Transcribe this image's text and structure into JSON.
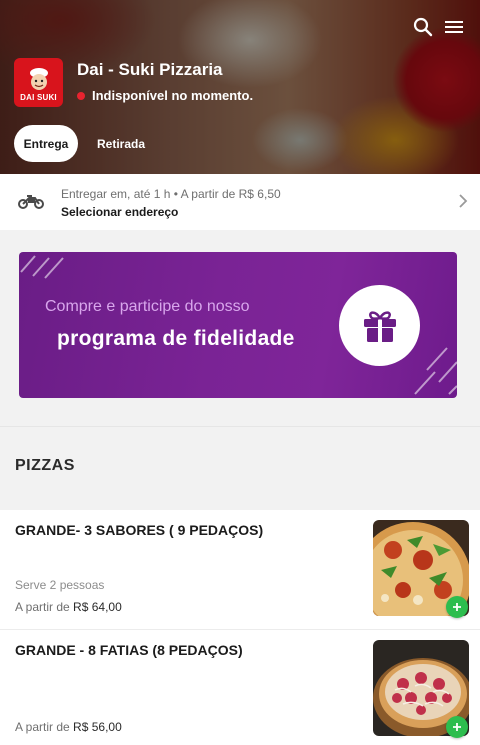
{
  "header": {
    "store_name": "Dai - Suki Pizzaria",
    "status_text": "Indisponível no momento.",
    "logo_text": "DAI SUKI",
    "tabs": [
      {
        "label": "Entrega",
        "active": true
      },
      {
        "label": "Retirada",
        "active": false
      }
    ],
    "icons": {
      "search": "search-icon",
      "menu": "hamburger-menu-icon"
    },
    "status_color": "#e8232f"
  },
  "delivery": {
    "info": "Entregar em, até 1 h • A partir de R$ 6,50",
    "action": "Selecionar endereço",
    "icon": "motorcycle-icon"
  },
  "banner": {
    "line1": "Compre e participe do nosso",
    "line2": "programa de fidelidade",
    "icon": "gift-icon",
    "color": "#7a2395"
  },
  "section": {
    "title": "PIZZAS"
  },
  "products": [
    {
      "name": "GRANDE- 3 SABORES ( 9 PEDAÇOS)",
      "serves": "Serve 2 pessoas",
      "price_prefix": "A partir de",
      "price": "R$ 64,00"
    },
    {
      "name": "GRANDE - 8 FATIAS (8 PEDAÇOS)",
      "serves": "",
      "price_prefix": "A partir de",
      "price": "R$ 56,00"
    }
  ],
  "colors": {
    "add_button": "#2dbd4e",
    "banner_purple": "#7a2395"
  }
}
